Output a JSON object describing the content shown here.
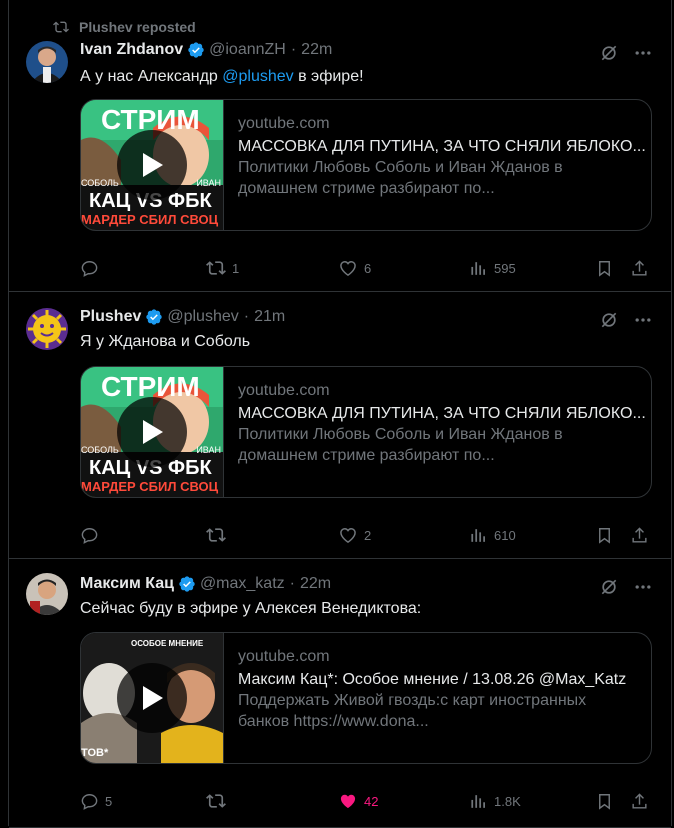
{
  "colors": {
    "accent": "#1d9bf0",
    "like": "#f91880",
    "muted": "#71767b",
    "background": "#000000"
  },
  "tweets": [
    {
      "repost_by": "Plushev reposted",
      "name": "Ivan Zhdanov",
      "handle": "@ioannZH",
      "time": "22m",
      "text_before": "А у нас Александр",
      "mention": "@plushev",
      "text_after": " в эфире!",
      "card": {
        "domain": "youtube.com",
        "title": "МАССОВКА ДЛЯ ПУТИНА, ЗА ЧТО СНЯЛИ ЯБЛОКО...",
        "desc": "Политики Любовь Соболь и Иван Жданов в домашнем стриме разбирают по...",
        "thumb_top": "СТРИМ",
        "thumb_left": "СОБОЛЬ",
        "thumb_right": "ИВАН",
        "thumb_main": "КАЦ VS ФБК",
        "thumb_bottom": "МАРДЕР СБИЛ СВОЦ"
      },
      "replies": "",
      "reposts": "1",
      "likes": "6",
      "views": "595"
    },
    {
      "name": "Plushev",
      "handle": "@plushev",
      "time": "21m",
      "text": "Я у Жданова и Соболь",
      "card": {
        "domain": "youtube.com",
        "title": "МАССОВКА ДЛЯ ПУТИНА, ЗА ЧТО СНЯЛИ ЯБЛОКО...",
        "desc": "Политики Любовь Соболь и Иван Жданов в домашнем стриме разбирают по...",
        "thumb_top": "СТРИМ",
        "thumb_left": "СОБОЛЬ",
        "thumb_right": "ИВАН",
        "thumb_main": "КАЦ VS ФБК",
        "thumb_bottom": "МАРДЕР СБИЛ СВОЦ"
      },
      "replies": "",
      "reposts": "",
      "likes": "2",
      "views": "610"
    },
    {
      "name": "Максим Кац",
      "handle": "@max_katz",
      "time": "22m",
      "text": "Сейчас буду в эфире у Алексея Венедиктова:",
      "card": {
        "domain": "youtube.com",
        "title": "Максим Кац*: Особое мнение / 13.08.26 @Max_Katz",
        "desc": "Поддержать Живой гвоздь:с карт иностранных банков https://www.dona...",
        "thumb_top": "ОСОБОЕ МНЕНИЕ",
        "thumb_bottom": "ТОВ*"
      },
      "replies": "5",
      "reposts": "",
      "likes": "42",
      "views": "1.8K"
    }
  ]
}
